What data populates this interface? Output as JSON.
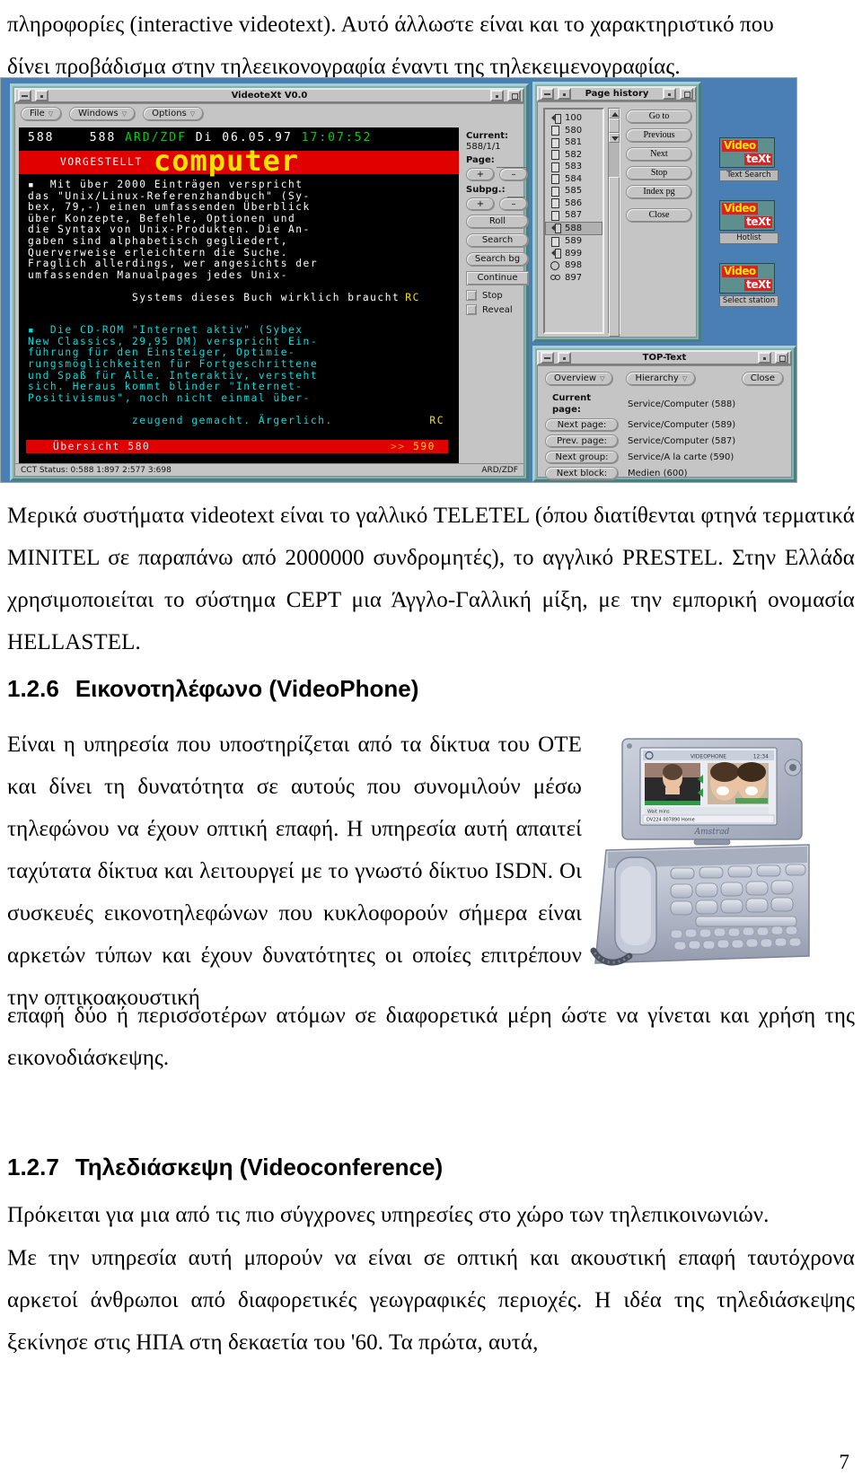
{
  "document": {
    "page_number": "7",
    "paragraphs": {
      "intro_line1": "πληροφορίες (interactive videotext). Αυτό άλλωστε είναι και το χαρακτηριστικό που",
      "intro_line2": "δίνει προβάδισμα στην τηλεεικονογραφία έναντι της τηλεκειμενογραφίας.",
      "after_figure": "Μερικά συστήματα videotext είναι το γαλλικό TELETEL (όπου διατίθενται φτηνά τερματικά MINITEL σε παραπάνω από 2000000 συνδρομητές), το αγγλικό PRESTEL. Στην Ελλάδα χρησιμοποιείται το σύστημα CEPT μια Άγγλο-Γαλλική μίξη, με την εμπορική ονομασία HELLASTEL.",
      "videophone_wrapped": "Είναι η υπηρεσία που υποστηρίζεται από τα δίκτυα του ΟΤΕ και δίνει τη δυνατότητα σε αυτούς που συνομιλούν μέσω τηλεφώνου να έχουν οπτική επαφή. Η υπηρεσία αυτή απαιτεί ταχύτατα δίκτυα και λειτουργεί με το γνωστό δίκτυο ISDN. Οι συσκευές εικονοτηλεφώνων που κυκλοφορούν σήμερα είναι αρκετών τύπων και έχουν δυνατότητες οι οποίες επιτρέπουν την οπτικοακουστική",
      "videophone_full": "επαφή δύο ή περισσοτέρων ατόμων σε διαφορετικά μέρη ώστε να γίνεται και χρήση της εικονοδιάσκεψης.",
      "videoconf_1": "Πρόκειται για μια από τις πιο σύγχρονες υπηρεσίες στο χώρο των τηλεπικοινωνιών.",
      "videoconf_2": "Με την υπηρεσία αυτή μπορούν να είναι σε οπτική και ακουστική επαφή ταυτόχρονα αρκετοί άνθρωποι από διαφορετικές γεωγραφικές περιοχές. Η ιδέα της τηλεδιάσκεψης ξεκίνησε στις ΗΠΑ στη δεκαετία του '60. Τα πρώτα, αυτά,"
    },
    "headings": [
      {
        "num": "1.2.6",
        "text": "Εικονοτηλέφωνο (VideoPhone)"
      },
      {
        "num": "1.2.7",
        "text": "Τηλεδιάσκεψη (Videoconference)"
      }
    ]
  },
  "figure": {
    "main_window": {
      "title": "VideoteXt V0.0",
      "menus": [
        {
          "label": "File"
        },
        {
          "label": "Windows"
        },
        {
          "label": "Options"
        }
      ],
      "status": {
        "cct": "CCT Status: 0:588 1:897 2:577 3:698",
        "station": "ARD/ZDF"
      }
    },
    "teletext": {
      "header": {
        "page_left": "588",
        "page_right": "588",
        "channel": "ARD/ZDF",
        "day": "Di",
        "date": "06.05.97",
        "time": "17:07:52"
      },
      "banner": {
        "label": "VORGESTELLT",
        "word": "computer"
      },
      "block1": [
        "▪  Mit über 2000 Einträgen verspricht",
        "das \"Unix/Linux-Referenzhandbuch\" (Sy-",
        "bex, 79,-) einen umfassenden Überblick",
        "über Konzepte, Befehle, Optionen und",
        "die Syntax von Unix-Produkten. Die An-",
        "gaben sind alphabetisch gegliedert,",
        "Querverweise erleichtern die Suche.",
        "Fraglich allerdings, wer angesichts der",
        "umfassenden Manualpages jedes Unix-",
        "Systems dieses Buch wirklich braucht"
      ],
      "block1_sig": "RC",
      "block2": [
        "▪  Die CD-ROM \"Internet aktiv\" (Sybex",
        "New Classics, 29,95 DM) verspricht Ein-",
        "führung für den Einsteiger, Optimie-",
        "rungsmöglichkeiten für Fortgeschrittene",
        "und Spaß für Alle. Interaktiv, versteht",
        "sich. Heraus kommt blinder \"Internet-",
        "Positivismus\", noch nicht einmal über-",
        "zeugend gemacht. Ärgerlich."
      ],
      "block2_sig": "RC",
      "footer": {
        "left": "Übersicht 580",
        "arrows": ">>",
        "right": "590"
      }
    },
    "control_panel": {
      "current_label": "Current:",
      "current_value": "588/1/1",
      "page_label": "Page:",
      "page_value": "",
      "page_plus": "+",
      "page_minus": "–",
      "subpg_label": "Subpg.:",
      "subpg_value": "",
      "subpg_plus": "+",
      "subpg_minus": "–",
      "roll": "Roll",
      "search": "Search",
      "search_bg": "Search bg",
      "continue": "Continue",
      "stop": "Stop",
      "reveal": "Reveal"
    },
    "page_history": {
      "title": "Page history",
      "items": [
        {
          "icon": "arrow-page-icon",
          "label": "100"
        },
        {
          "icon": "page-icon",
          "label": "580"
        },
        {
          "icon": "page-icon",
          "label": "581"
        },
        {
          "icon": "page-icon",
          "label": "582"
        },
        {
          "icon": "page-icon",
          "label": "583"
        },
        {
          "icon": "page-icon",
          "label": "584"
        },
        {
          "icon": "page-icon",
          "label": "585"
        },
        {
          "icon": "page-icon",
          "label": "586"
        },
        {
          "icon": "page-icon",
          "label": "587"
        },
        {
          "icon": "arrow-page-icon",
          "label": "588",
          "selected": true
        },
        {
          "icon": "page-icon",
          "label": "589"
        },
        {
          "icon": "arrow-page-icon",
          "label": "899"
        },
        {
          "icon": "clock-icon",
          "label": "898"
        },
        {
          "icon": "glasses-icon",
          "label": "897"
        }
      ],
      "buttons": [
        "Go to",
        "Previous",
        "Next",
        "Stop",
        "Index pg",
        "Close"
      ]
    },
    "top_text": {
      "title": "TOP-Text",
      "overview_btn": "Overview",
      "hierarchy_btn": "Hierarchy",
      "close_btn": "Close",
      "rows": [
        {
          "key": "Current page:",
          "value": "Service/Computer (588)",
          "static": true
        },
        {
          "key": "Next page:",
          "value": "Service/Computer (589)"
        },
        {
          "key": "Prev. page:",
          "value": "Service/Computer (587)"
        },
        {
          "key": "Next group:",
          "value": "Service/A la carte (590)"
        },
        {
          "key": "Next block:",
          "value": "Medien (600)"
        }
      ]
    },
    "desktop_icons": [
      {
        "caption": "Text Search",
        "word_top": "Video",
        "word_bottom": "teXt"
      },
      {
        "caption": "Hotlist",
        "word_top": "Video",
        "word_bottom": "teXt"
      },
      {
        "caption": "Select station",
        "word_top": "Video",
        "word_bottom": "teXt"
      }
    ]
  },
  "videophone_photo": {
    "brand": "Amstrad",
    "screen_title": "VIDEOPHONE",
    "screen_time": "12:34",
    "screen_caption": "DV224  007890 Home",
    "screen_hint": "Wait  mins"
  }
}
